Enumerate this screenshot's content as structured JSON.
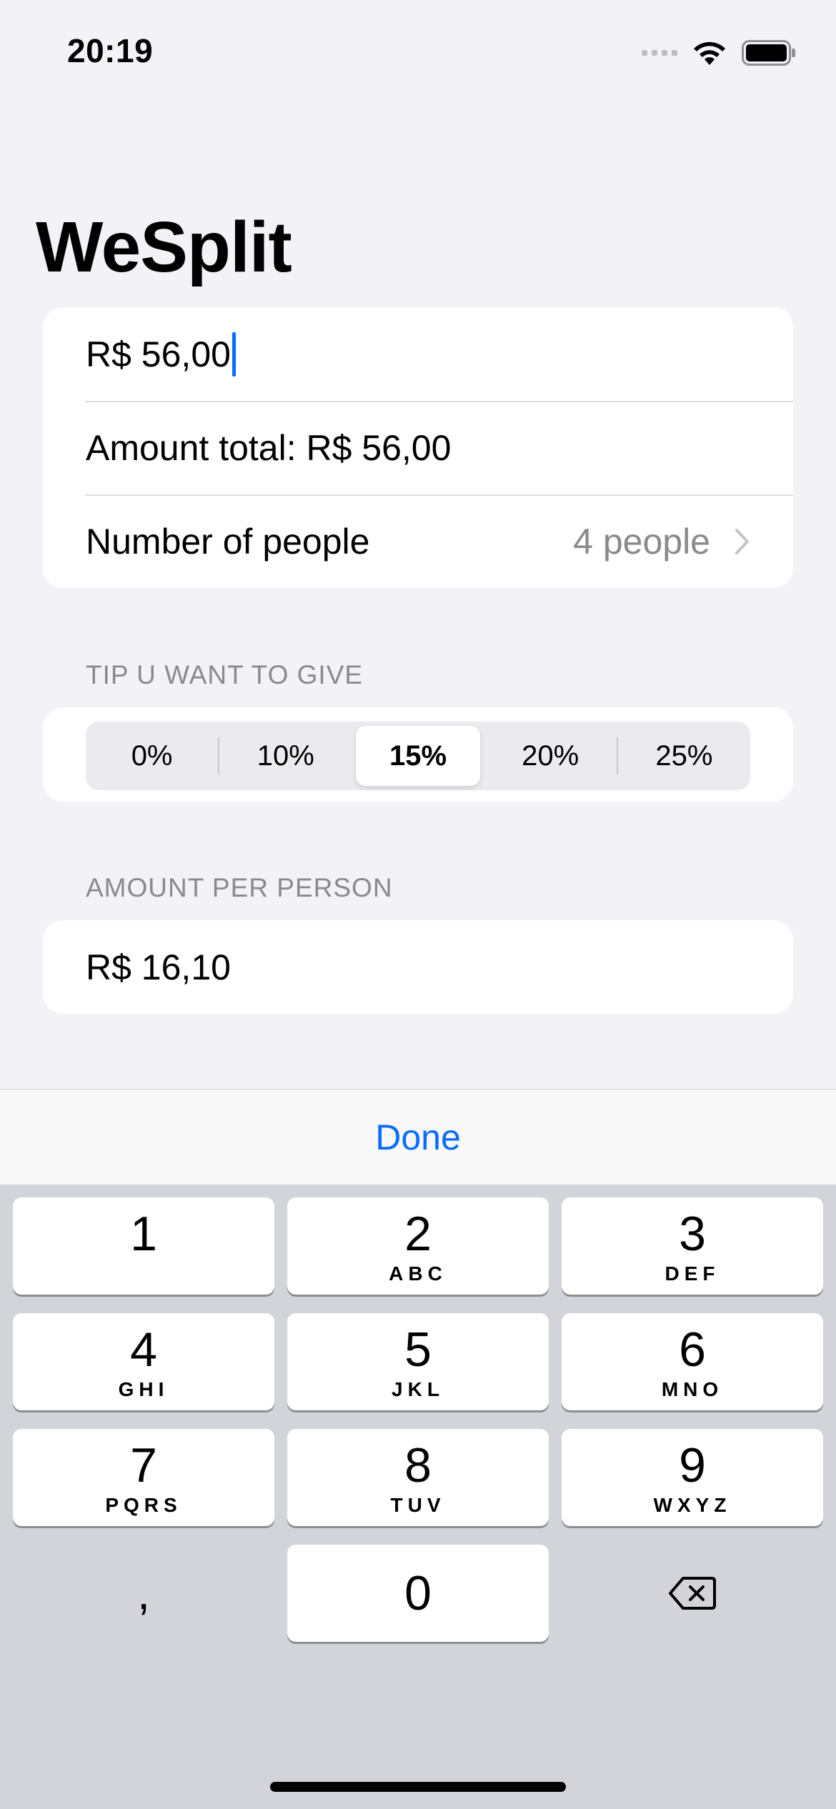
{
  "status_bar": {
    "time": "20:19"
  },
  "title": "WeSplit",
  "amount_input": {
    "value": "R$ 56,00"
  },
  "amount_total": "Amount total: R$ 56,00",
  "people": {
    "label": "Number of people",
    "value": "4 people"
  },
  "tip_section": {
    "header": "TIP U WANT TO GIVE",
    "options": [
      "0%",
      "10%",
      "15%",
      "20%",
      "25%"
    ],
    "selected": "15%"
  },
  "per_person": {
    "header": "AMOUNT PER PERSON",
    "value": "R$ 16,10"
  },
  "toolbar": {
    "done_label": "Done"
  },
  "keypad": [
    {
      "num": "1",
      "letters": ""
    },
    {
      "num": "2",
      "letters": "ABC"
    },
    {
      "num": "3",
      "letters": "DEF"
    },
    {
      "num": "4",
      "letters": "GHI"
    },
    {
      "num": "5",
      "letters": "JKL"
    },
    {
      "num": "6",
      "letters": "MNO"
    },
    {
      "num": "7",
      "letters": "PQRS"
    },
    {
      "num": "8",
      "letters": "TUV"
    },
    {
      "num": "9",
      "letters": "WXYZ"
    },
    {
      "num": "0",
      "letters": ""
    }
  ],
  "decimal_key": ",",
  "colors": {
    "accent": "#0a6cff",
    "background": "#f2f2f7",
    "keyboard": "#d2d4da"
  },
  "icons": [
    "signal-icon",
    "wifi-icon",
    "battery-icon",
    "chevron-right-icon",
    "delete-backward-icon"
  ]
}
